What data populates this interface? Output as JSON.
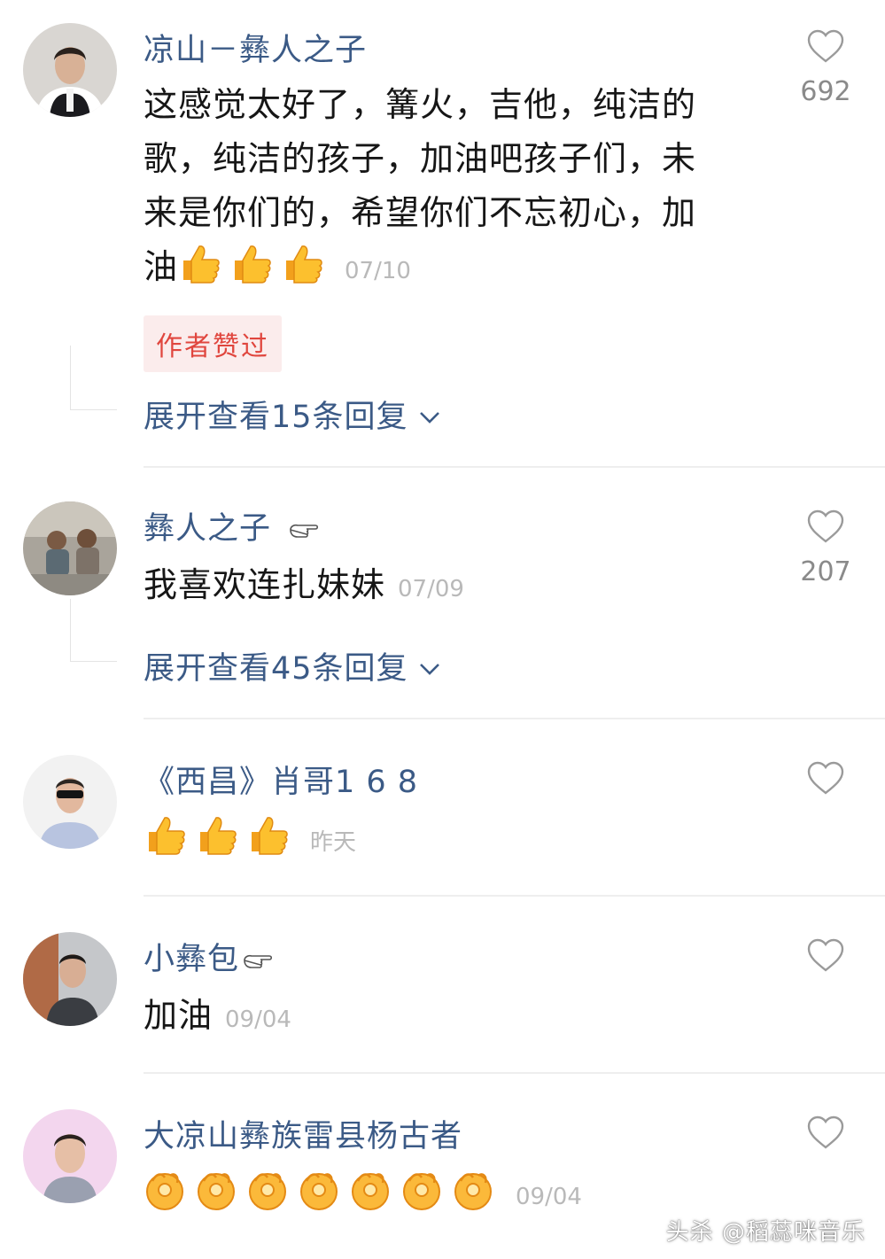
{
  "comments": [
    {
      "username": "凉山－彝人之子",
      "text": "这感觉太好了，篝火，吉他，纯洁的歌，纯洁的孩子，加油吧孩子们，未来是你们的，希望你们不忘初心，加油",
      "emojis": [
        "thumbs-up",
        "thumbs-up",
        "thumbs-up"
      ],
      "date": "07/10",
      "likes": "692",
      "badge": "作者赞过",
      "expand_label": "展开查看15条回复"
    },
    {
      "username": "彝人之子",
      "text": "我喜欢连扎妹妹",
      "date": "07/09",
      "likes": "207",
      "expand_label": "展开查看45条回复"
    },
    {
      "username": "《西昌》肖哥1 6 8",
      "emojis": [
        "thumbs-up",
        "thumbs-up",
        "thumbs-up"
      ],
      "date": "昨天"
    },
    {
      "username": "小彝包",
      "text": "加油",
      "date": "09/04"
    },
    {
      "username": "大凉山彝族雷县杨古者",
      "emojis": [
        "ok-hand",
        "ok-hand",
        "ok-hand",
        "ok-hand",
        "ok-hand",
        "ok-hand",
        "ok-hand"
      ],
      "date": "09/04"
    }
  ],
  "watermark": "头杀 @稻蕊咪音乐",
  "colors": {
    "username": "#3b5a86",
    "badge_text": "#e0463e",
    "badge_bg": "#fbecec",
    "date": "#b9b9b9",
    "heart": "#9a9a9a"
  },
  "icons": {
    "like": "heart-outline-icon",
    "expand": "chevron-down-icon",
    "pointer": "pointing-hand-icon"
  }
}
